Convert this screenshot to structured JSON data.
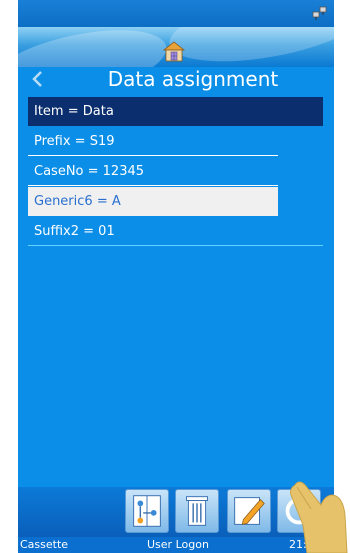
{
  "header": {
    "title": "Data assignment"
  },
  "list": {
    "header": "Item = Data",
    "items": [
      {
        "label": "Prefix = S19"
      },
      {
        "label": "CaseNo = 12345"
      },
      {
        "label": "Generic6 = A",
        "selected": true
      },
      {
        "label": "Suffix2 = 01"
      }
    ]
  },
  "toolbar": {
    "buttons": [
      "data-assign-icon",
      "trash-icon",
      "edit-icon",
      "refresh-icon"
    ]
  },
  "status": {
    "left": "Cassette",
    "center": "User Logon",
    "time": "21:11"
  },
  "colors": {
    "screen_bg": "#0a8ee8",
    "header_row": "#0a2e6e",
    "selected_row": "#f0f0f0",
    "accent_line": "#62d2ff"
  }
}
